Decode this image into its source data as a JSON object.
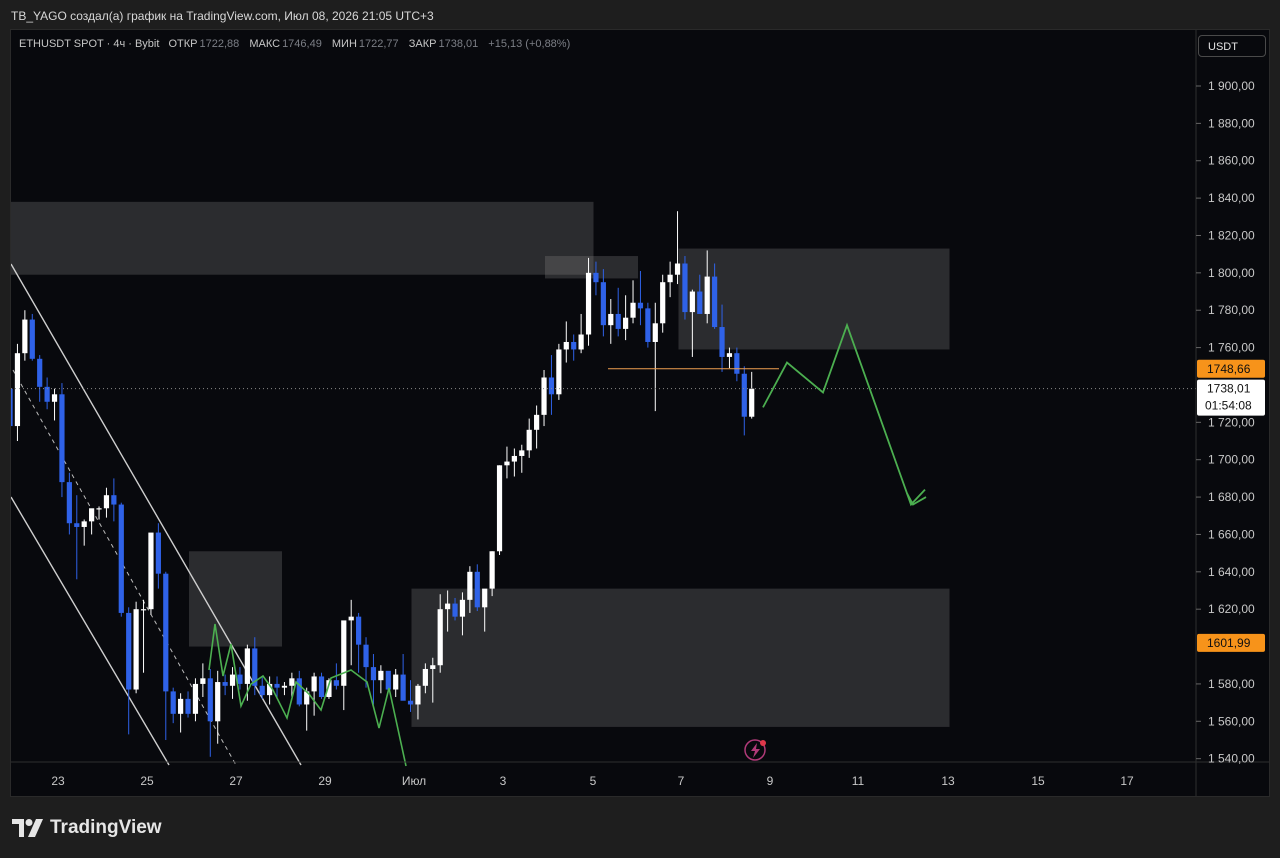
{
  "header": {
    "caption": "TB_YAGO создал(а) график на TradingView.com, Июл 08, 2026 21:05 UTC+3"
  },
  "legend": {
    "symbol": "ETHUSDT SPOT · 4ч · Bybit",
    "open_label": "ОТКР",
    "open": "1722,88",
    "high_label": "МАКС",
    "high": "1746,49",
    "low_label": "МИН",
    "low": "1722,77",
    "close_label": "ЗАКР",
    "close": "1738,01",
    "change": "+15,13 (+0,88%)"
  },
  "currency": "USDT",
  "price_tags": {
    "level_high": "1748,66",
    "last_price": "1738,01",
    "countdown": "01:54:08",
    "level_low": "1601,99"
  },
  "footer": {
    "brand": "TradingView"
  },
  "colors": {
    "up": "#ffffff",
    "down": "#2f62e8",
    "forecast": "#4caf50",
    "tag_orange": "#f7931a",
    "zone": "#8a8a8a"
  },
  "chart_data": {
    "type": "candlestick",
    "symbol": "ETHUSDT SPOT",
    "timeframe": "4ч",
    "exchange": "Bybit",
    "y_axis": {
      "range": [
        1536,
        1918
      ],
      "ticks": [
        "1 900,00",
        "1 880,00",
        "1 860,00",
        "1 840,00",
        "1 820,00",
        "1 800,00",
        "1 780,00",
        "1 760,00",
        "1 720,00",
        "1 700,00",
        "1 680,00",
        "1 660,00",
        "1 640,00",
        "1 620,00",
        "1 580,00",
        "1 560,00",
        "1 540,00"
      ]
    },
    "x_axis": {
      "ticks": [
        "23",
        "25",
        "27",
        "29",
        "Июл",
        "3",
        "5",
        "7",
        "9",
        "11",
        "13",
        "15",
        "17"
      ]
    },
    "zones": [
      {
        "from": "Jun 22",
        "to": "Jul 5",
        "low": 1799,
        "high": 1838
      },
      {
        "from": "Jun 26",
        "to": "Jun 28",
        "low": 1600,
        "high": 1651
      },
      {
        "from": "Jul 1",
        "to": "Jul 13",
        "low": 1557,
        "high": 1631
      },
      {
        "from": "Jul 7",
        "to": "Jul 13",
        "low": 1759,
        "high": 1813
      },
      {
        "from": "Jul 4",
        "to": "Jul 6",
        "low": 1797,
        "high": 1809
      }
    ],
    "channel": {
      "upper": [
        [
          1804,
          1548
        ],
        [
          "Jun 29",
          1538
        ]
      ],
      "lower": [
        [
          1680,
          1541
        ],
        [
          1552,
          1538
        ]
      ]
    },
    "forecast_path": [
      1728,
      1752,
      1736,
      1772,
      1676,
      1684
    ],
    "support_line": 1748.66,
    "current_price": 1738.01,
    "candles": [
      [
        1738,
        1748,
        1713,
        1718
      ],
      [
        1718,
        1762,
        1710,
        1757
      ],
      [
        1757,
        1780,
        1753,
        1775
      ],
      [
        1775,
        1778,
        1753,
        1754
      ],
      [
        1754,
        1756,
        1731,
        1739
      ],
      [
        1739,
        1744,
        1727,
        1731
      ],
      [
        1731,
        1738,
        1721,
        1735
      ],
      [
        1735,
        1741,
        1680,
        1688
      ],
      [
        1688,
        1693,
        1660,
        1666
      ],
      [
        1666,
        1681,
        1636,
        1664
      ],
      [
        1664,
        1668,
        1654,
        1667
      ],
      [
        1667,
        1672,
        1660,
        1674
      ],
      [
        1674,
        1675,
        1668,
        1674
      ],
      [
        1674,
        1685,
        1669,
        1681
      ],
      [
        1681,
        1690,
        1667,
        1676
      ],
      [
        1676,
        1677,
        1616,
        1618
      ],
      [
        1618,
        1621,
        1553,
        1577
      ],
      [
        1577,
        1624,
        1575,
        1620
      ],
      [
        1620,
        1625,
        1586,
        1620
      ],
      [
        1620,
        1660,
        1617,
        1661
      ],
      [
        1661,
        1666,
        1631,
        1639
      ],
      [
        1639,
        1640,
        1550,
        1576
      ],
      [
        1576,
        1578,
        1559,
        1564
      ],
      [
        1564,
        1575,
        1554,
        1572
      ],
      [
        1572,
        1576,
        1562,
        1564
      ],
      [
        1564,
        1583,
        1560,
        1580
      ],
      [
        1580,
        1591,
        1573,
        1583
      ],
      [
        1583,
        1588,
        1541,
        1560
      ],
      [
        1560,
        1587,
        1548,
        1581
      ],
      [
        1581,
        1585,
        1574,
        1579
      ],
      [
        1579,
        1589,
        1572,
        1585
      ],
      [
        1585,
        1589,
        1577,
        1580
      ],
      [
        1580,
        1601,
        1571,
        1599
      ],
      [
        1599,
        1605,
        1574,
        1579
      ],
      [
        1579,
        1584,
        1572,
        1574
      ],
      [
        1574,
        1584,
        1569,
        1580
      ],
      [
        1580,
        1584,
        1572,
        1578
      ],
      [
        1578,
        1581,
        1574,
        1579
      ],
      [
        1579,
        1586,
        1573,
        1583
      ],
      [
        1583,
        1587,
        1568,
        1569
      ],
      [
        1569,
        1578,
        1555,
        1576
      ],
      [
        1576,
        1586,
        1563,
        1584
      ],
      [
        1584,
        1586,
        1572,
        1573
      ],
      [
        1573,
        1583,
        1572,
        1582
      ],
      [
        1582,
        1591,
        1577,
        1579
      ],
      [
        1579,
        1595,
        1566,
        1614
      ],
      [
        1614,
        1625,
        1590,
        1616
      ],
      [
        1616,
        1618,
        1586,
        1601
      ],
      [
        1601,
        1605,
        1578,
        1589
      ],
      [
        1589,
        1596,
        1569,
        1582
      ],
      [
        1582,
        1590,
        1575,
        1587
      ],
      [
        1587,
        1586,
        1576,
        1577
      ],
      [
        1577,
        1588,
        1573,
        1585
      ],
      [
        1585,
        1596,
        1572,
        1571
      ],
      [
        1571,
        1582,
        1565,
        1569
      ],
      [
        1569,
        1580,
        1561,
        1579
      ],
      [
        1579,
        1591,
        1575,
        1588
      ],
      [
        1588,
        1594,
        1570,
        1590
      ],
      [
        1590,
        1628,
        1586,
        1620
      ],
      [
        1620,
        1630,
        1608,
        1623
      ],
      [
        1623,
        1626,
        1614,
        1616
      ],
      [
        1616,
        1629,
        1606,
        1625
      ],
      [
        1625,
        1643,
        1618,
        1640
      ],
      [
        1640,
        1644,
        1619,
        1621
      ],
      [
        1621,
        1625,
        1608,
        1631
      ],
      [
        1631,
        1651,
        1627,
        1651
      ],
      [
        1651,
        1697,
        1649,
        1697
      ],
      [
        1697,
        1707,
        1690,
        1699
      ],
      [
        1699,
        1706,
        1691,
        1702
      ],
      [
        1702,
        1708,
        1693,
        1705
      ],
      [
        1705,
        1722,
        1701,
        1716
      ],
      [
        1716,
        1729,
        1706,
        1724
      ],
      [
        1724,
        1748,
        1718,
        1744
      ],
      [
        1744,
        1756,
        1724,
        1735
      ],
      [
        1735,
        1762,
        1732,
        1759
      ],
      [
        1759,
        1774,
        1752,
        1763
      ],
      [
        1763,
        1767,
        1753,
        1759
      ],
      [
        1759,
        1778,
        1757,
        1767
      ],
      [
        1767,
        1808,
        1761,
        1800
      ],
      [
        1800,
        1806,
        1788,
        1795
      ],
      [
        1795,
        1802,
        1766,
        1772
      ],
      [
        1772,
        1786,
        1762,
        1778
      ],
      [
        1778,
        1792,
        1766,
        1770
      ],
      [
        1770,
        1788,
        1764,
        1776
      ],
      [
        1776,
        1796,
        1773,
        1784
      ],
      [
        1784,
        1801,
        1772,
        1781
      ],
      [
        1781,
        1784,
        1760,
        1763
      ],
      [
        1763,
        1784,
        1726,
        1773
      ],
      [
        1773,
        1799,
        1768,
        1795
      ],
      [
        1795,
        1806,
        1787,
        1799
      ],
      [
        1799,
        1833,
        1794,
        1805
      ],
      [
        1805,
        1809,
        1775,
        1779
      ],
      [
        1779,
        1791,
        1755,
        1790
      ],
      [
        1790,
        1799,
        1780,
        1778
      ],
      [
        1778,
        1812,
        1773,
        1798
      ],
      [
        1798,
        1805,
        1770,
        1771
      ],
      [
        1771,
        1783,
        1747,
        1755
      ],
      [
        1755,
        1760,
        1749,
        1757
      ],
      [
        1757,
        1760,
        1742,
        1746
      ],
      [
        1746,
        1750,
        1713,
        1723
      ],
      [
        1723,
        1747,
        1722,
        1738
      ]
    ]
  }
}
